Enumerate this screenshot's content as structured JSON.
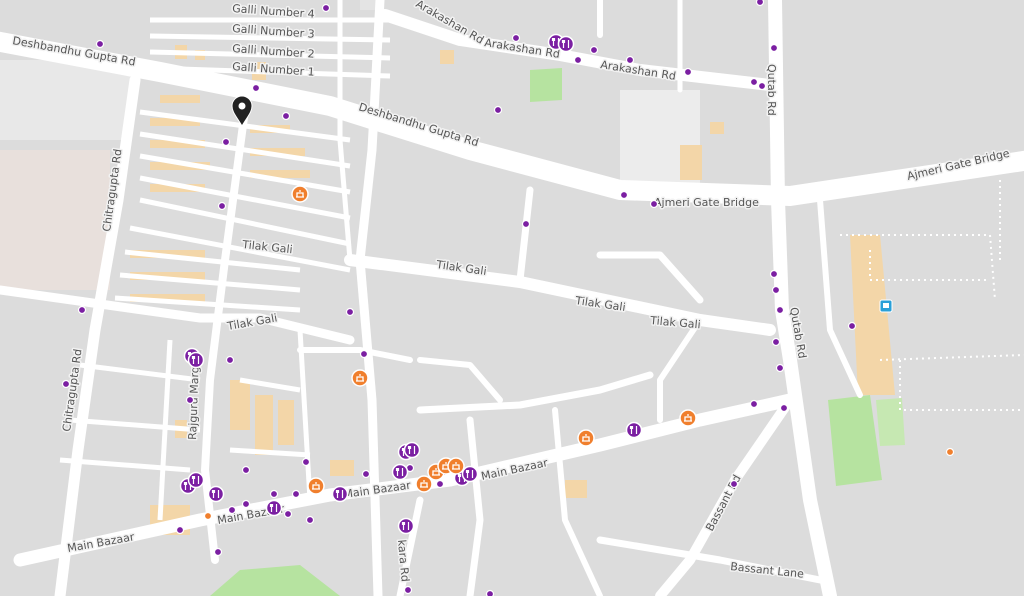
{
  "map": {
    "colors": {
      "background": "#dcdcdc",
      "road": "#ffffff",
      "block": "#e6e6e6",
      "building": "#f3d6a8",
      "park": "#b6e3a0",
      "poi_purple": "#7b1fa2",
      "poi_orange": "#f07f2d",
      "pin": "#222222",
      "label": "#555555"
    },
    "street_labels": {
      "galli_4": "Galli Number 4",
      "galli_3": "Galli Number 3",
      "galli_2": "Galli Number 2",
      "galli_1": "Galli Number 1",
      "deshbandhu_west": "Deshbandhu Gupta Rd",
      "deshbandhu_east": "Deshbandhu Gupta Rd",
      "arakashan_north": "Arakashan Rd",
      "arakashan_east": "Arakashan Rd",
      "arakashan_sw": "Arakashan Rd",
      "ajmeri_bridge_1": "Ajmeri Gate Bridge",
      "ajmeri_bridge_2": "Ajmeri Gate Bridge",
      "qutab_north": "Qutab Rd",
      "qutab_mid": "Qutab Rd",
      "chitragupta_north": "Chitragupta Rd",
      "chitragupta_south": "Chitragupta Rd",
      "tilak_1": "Tilak Gali",
      "tilak_2": "Tilak Gali",
      "tilak_3": "Tilak Gali",
      "tilak_4": "Tilak Gali",
      "tilak_5": "Tilak Gali",
      "rajguru": "Rajguru Marg",
      "main_bazaar_1": "Main Bazaar",
      "main_bazaar_2": "Main Bazaar",
      "main_bazaar_3": "Main Bazaar",
      "main_bazaar_4": "Main Bazaar",
      "bassant_rd": "Bassant Rd",
      "bassant_lane": "Bassant Lane",
      "kara_rd": "kara Rd"
    },
    "icons": {
      "restaurant": "restaurant-icon",
      "hotel": "hotel-icon",
      "metro": "metro-station-icon",
      "pin": "location-pin-icon"
    }
  }
}
